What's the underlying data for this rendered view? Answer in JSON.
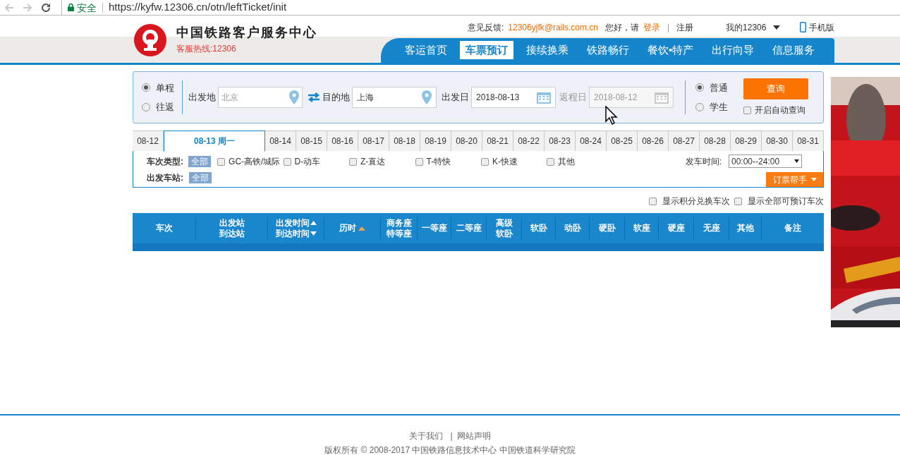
{
  "browser": {
    "security": "安全",
    "url": "https://kyfw.12306.cn/otn/leftTicket/init"
  },
  "header": {
    "title": "中国铁路客户服务中心",
    "hotline": "客服热线:12306",
    "feedback_label": "意见反馈:",
    "feedback_email": "12306yjfk@rails.com.cn",
    "greeting": "您好，请",
    "login": "登录",
    "separator": "|",
    "register": "注册",
    "my_account": "我的12306",
    "mobile": "手机版"
  },
  "nav": [
    {
      "label": "客运首页",
      "selected": false
    },
    {
      "label": "车票预订",
      "selected": true
    },
    {
      "label": "接续换乘",
      "selected": false
    },
    {
      "label": "铁路畅行",
      "selected": false
    },
    {
      "label": "餐饮•特产",
      "selected": false
    },
    {
      "label": "出行向导",
      "selected": false
    },
    {
      "label": "信息服务",
      "selected": false
    }
  ],
  "search": {
    "trip_types": [
      {
        "label": "单程",
        "selected": true
      },
      {
        "label": "往返",
        "selected": false
      }
    ],
    "from": {
      "label": "出发地",
      "placeholder": "北京"
    },
    "to": {
      "label": "目的地",
      "value": "上海"
    },
    "depart": {
      "label": "出发日",
      "value": "2018-08-13",
      "disabled": false
    },
    "return": {
      "label": "返程日",
      "value": "2018-08-12",
      "disabled": true
    },
    "passenger_types": [
      {
        "label": "普通",
        "selected": true
      },
      {
        "label": "学生",
        "selected": false
      }
    ],
    "query_button": "查询",
    "auto_query": {
      "label": "开启自动查询",
      "checked": false
    }
  },
  "date_tabs": [
    {
      "label": "08-12",
      "selected": false
    },
    {
      "label": "08-13 周一",
      "selected": true
    },
    {
      "label": "08-14",
      "selected": false
    },
    {
      "label": "08-15",
      "selected": false
    },
    {
      "label": "08-16",
      "selected": false
    },
    {
      "label": "08-17",
      "selected": false
    },
    {
      "label": "08-18",
      "selected": false
    },
    {
      "label": "08-19",
      "selected": false
    },
    {
      "label": "08-20",
      "selected": false
    },
    {
      "label": "08-21",
      "selected": false
    },
    {
      "label": "08-22",
      "selected": false
    },
    {
      "label": "08-23",
      "selected": false
    },
    {
      "label": "08-24",
      "selected": false
    },
    {
      "label": "08-25",
      "selected": false
    },
    {
      "label": "08-26",
      "selected": false
    },
    {
      "label": "08-27",
      "selected": false
    },
    {
      "label": "08-28",
      "selected": false
    },
    {
      "label": "08-29",
      "selected": false
    },
    {
      "label": "08-30",
      "selected": false
    },
    {
      "label": "08-31",
      "selected": false
    }
  ],
  "filters": {
    "train_type_label": "车次类型:",
    "train_type_all": "全部",
    "train_types": [
      {
        "label": "GC-高铁/城际",
        "checked": false
      },
      {
        "label": "D-动车",
        "checked": false
      },
      {
        "label": "Z-直达",
        "checked": false
      },
      {
        "label": "T-特快",
        "checked": false
      },
      {
        "label": "K-快速",
        "checked": false
      },
      {
        "label": "其他",
        "checked": false
      }
    ],
    "station_label": "出发车站:",
    "station_all": "全部",
    "time_label": "发车时间:",
    "time_value": "00:00--24:00",
    "helper_button": "订票帮手"
  },
  "options": [
    {
      "label": "显示积分兑换车次",
      "checked": false
    },
    {
      "label": "显示全部可预订车次",
      "checked": false
    }
  ],
  "table": {
    "columns": [
      {
        "lines": [
          "车次"
        ]
      },
      {
        "lines": [
          "出发站",
          "到达站"
        ]
      },
      {
        "lines": [
          "出发时间",
          "到达时间"
        ],
        "sortable": true,
        "sorted": false
      },
      {
        "lines": [
          "历时"
        ],
        "sortable": true,
        "sorted": true
      },
      {
        "lines": [
          "商务座",
          "特等座"
        ]
      },
      {
        "lines": [
          "一等座"
        ]
      },
      {
        "lines": [
          "二等座"
        ]
      },
      {
        "lines": [
          "高级",
          "软卧"
        ]
      },
      {
        "lines": [
          "软卧"
        ]
      },
      {
        "lines": [
          "动卧"
        ]
      },
      {
        "lines": [
          "硬卧"
        ]
      },
      {
        "lines": [
          "软座"
        ]
      },
      {
        "lines": [
          "硬座"
        ]
      },
      {
        "lines": [
          "无座"
        ]
      },
      {
        "lines": [
          "其他"
        ]
      },
      {
        "lines": [
          "备注"
        ]
      }
    ]
  },
  "footer": {
    "links": [
      "关于我们",
      "网站声明"
    ],
    "separator": "|",
    "copyright": "版权所有 © 2008-2017 中国铁路信息技术中心 中国铁道科学研究院"
  }
}
